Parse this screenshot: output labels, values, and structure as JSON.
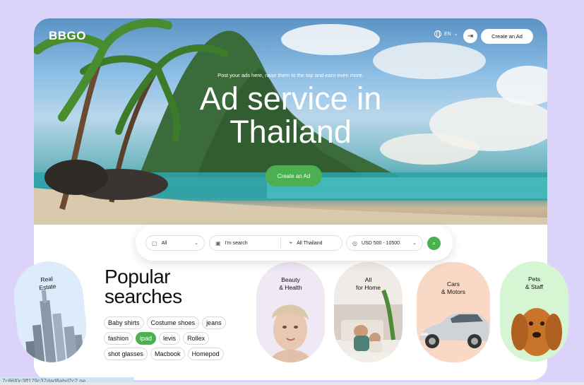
{
  "header": {
    "logo": "BBGO",
    "language": "EN",
    "create_ad_label": "Create an Ad"
  },
  "hero": {
    "tagline": "Post your ads here, raise them to the top and earn even more.",
    "headline_line1": "Ad service in",
    "headline_line2": "Thailand",
    "cta_label": "Create an Ad"
  },
  "search": {
    "category_value": "All",
    "query_placeholder": "I'm search",
    "location_value": "All Thailand",
    "price_value": "USD 500 - 10500"
  },
  "popular": {
    "title_line1": "Popular",
    "title_line2": "searches",
    "tags": [
      [
        "Baby shirts",
        "Costume shoes",
        "jeans"
      ],
      [
        "fashion",
        "ipad",
        "levis",
        "Rollex"
      ],
      [
        "shot glasses",
        "Macbook",
        "Homepod"
      ]
    ],
    "active_tag": "ipad"
  },
  "categories": [
    {
      "line1": "Real",
      "line2": "Estate",
      "color": "#dcecfb"
    },
    {
      "line1": "Beauty",
      "line2": "& Health",
      "color": "#efe8f5"
    },
    {
      "line1": "All",
      "line2": "for Home",
      "color": "#f0ebe6"
    },
    {
      "line1": "Cars",
      "line2": "& Motors",
      "color": "#f9d9c6"
    },
    {
      "line1": "Pets",
      "line2": "& Staff",
      "color": "#d5f5d3"
    }
  ],
  "status_bar": "7c86f0c3ff179c37dad8abd2c2 ne",
  "colors": {
    "accent": "#4cb050",
    "background": "#dcd3fb"
  }
}
